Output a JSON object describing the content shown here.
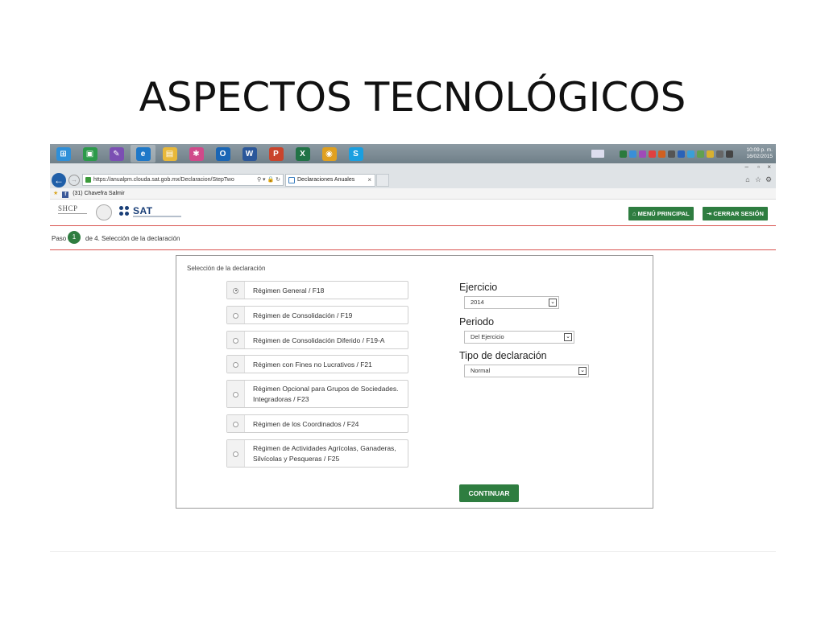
{
  "slide": {
    "title": "ASPECTOS TECNOLÓGICOS"
  },
  "taskbar": {
    "apps": [
      {
        "name": "windows-start",
        "color": "#2f8fd8",
        "glyph": "⊞"
      },
      {
        "name": "store",
        "color": "#2c9a4a",
        "glyph": "▣"
      },
      {
        "name": "onenote-like",
        "color": "#7b4fb3",
        "glyph": "✎"
      },
      {
        "name": "internet-explorer",
        "color": "#1e78c8",
        "glyph": "e"
      },
      {
        "name": "file-explorer",
        "color": "#e8b83a",
        "glyph": "▤"
      },
      {
        "name": "photos",
        "color": "#d04a8a",
        "glyph": "✱"
      },
      {
        "name": "outlook",
        "color": "#1a66b5",
        "glyph": "O"
      },
      {
        "name": "word",
        "color": "#2b579a",
        "glyph": "W"
      },
      {
        "name": "powerpoint",
        "color": "#c9442c",
        "glyph": "P"
      },
      {
        "name": "excel",
        "color": "#217346",
        "glyph": "X"
      },
      {
        "name": "chrome",
        "color": "#e0a020",
        "glyph": "◉"
      },
      {
        "name": "skype",
        "color": "#1a9fe0",
        "glyph": "S"
      }
    ],
    "tray_colors": [
      "#2b7a3c",
      "#3a8fd8",
      "#a04ab8",
      "#e04040",
      "#d06020",
      "#555555",
      "#2a62b8",
      "#3a9fd8",
      "#60a050",
      "#d8b030",
      "#666666",
      "#444444"
    ],
    "clock_time": "10:09 p. m.",
    "clock_date": "16/02/2015"
  },
  "browser": {
    "address": "https://anualpm.clouda.sat.gob.mx/Declaracion/StepTwo",
    "address_tools": "⚲ ▾ 🔒 ↻",
    "tab_label": "Declaraciones Anuales",
    "tab_close": "×",
    "back": "←",
    "forward": "→",
    "favorite": "(31) Chavefra Salmir",
    "win_min": "–",
    "win_max": "▫",
    "win_close": "×"
  },
  "header": {
    "shcp": "SHCP",
    "sat": "SAT",
    "menu_button": "MENÚ PRINCIPAL",
    "logout_button": "CERRAR SESIÓN"
  },
  "stepbar": {
    "paso": "Paso",
    "number": "1",
    "text": "de 4. Selección de la declaración"
  },
  "form": {
    "title": "Selección de la declaración",
    "regimenes": [
      {
        "label": "Régimen General / F18",
        "selected": true
      },
      {
        "label": "Régimen de Consolidación / F19",
        "selected": false
      },
      {
        "label": "Régimen de Consolidación Diferido / F19-A",
        "selected": false
      },
      {
        "label": "Régimen con Fines no Lucrativos / F21",
        "selected": false
      },
      {
        "label": "Régimen Opcional para Grupos de Sociedades. Integradoras / F23",
        "selected": false
      },
      {
        "label": "Régimen de los Coordinados / F24",
        "selected": false
      },
      {
        "label": "Régimen de Actividades Agrícolas, Ganaderas, Silvícolas y Pesqueras / F25",
        "selected": false
      }
    ],
    "ejercicio_label": "Ejercicio",
    "ejercicio_value": "2014",
    "periodo_label": "Periodo",
    "periodo_value": "Del Ejercicio",
    "tipo_label": "Tipo de declaración",
    "tipo_value": "Normal",
    "continuar": "CONTINUAR"
  },
  "colors": {
    "green": "#2e7d40",
    "red_line": "#d9534f",
    "sat_blue": "#1a3f78"
  }
}
